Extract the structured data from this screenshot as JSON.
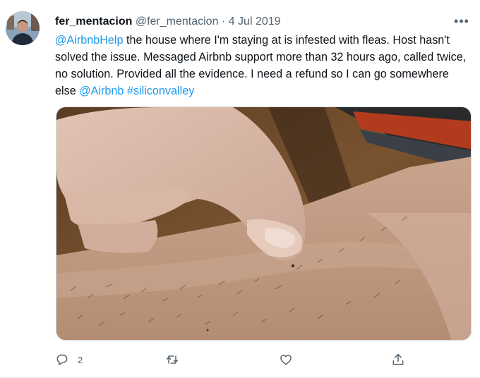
{
  "tweet": {
    "author_name": "fer_mentacion",
    "author_handle": "@fer_mentacion",
    "separator": "·",
    "date": "4 Jul 2019",
    "more_label": "•••",
    "text_segments": [
      {
        "type": "mention",
        "text": "@AirbnbHelp"
      },
      {
        "type": "text",
        "text": " the house where I'm staying at is infested with fleas. Host hasn't solved the issue. Messaged Airbnb support more than 32 hours ago, called twice, no solution. Provided all the evidence. I need a refund so I can go somewhere else "
      },
      {
        "type": "mention",
        "text": "@Airbnb"
      },
      {
        "type": "text",
        "text": " "
      },
      {
        "type": "hashtag",
        "text": "#siliconvalley"
      }
    ],
    "actions": {
      "reply_count": "2",
      "retweet_count": "",
      "like_count": ""
    }
  },
  "colors": {
    "link": "#1d9bf0",
    "secondary_text": "#536471",
    "primary_text": "#0f1419"
  },
  "icons": {
    "reply": "reply-icon",
    "retweet": "retweet-icon",
    "like": "heart-icon",
    "share": "share-icon",
    "more": "more-icon"
  }
}
